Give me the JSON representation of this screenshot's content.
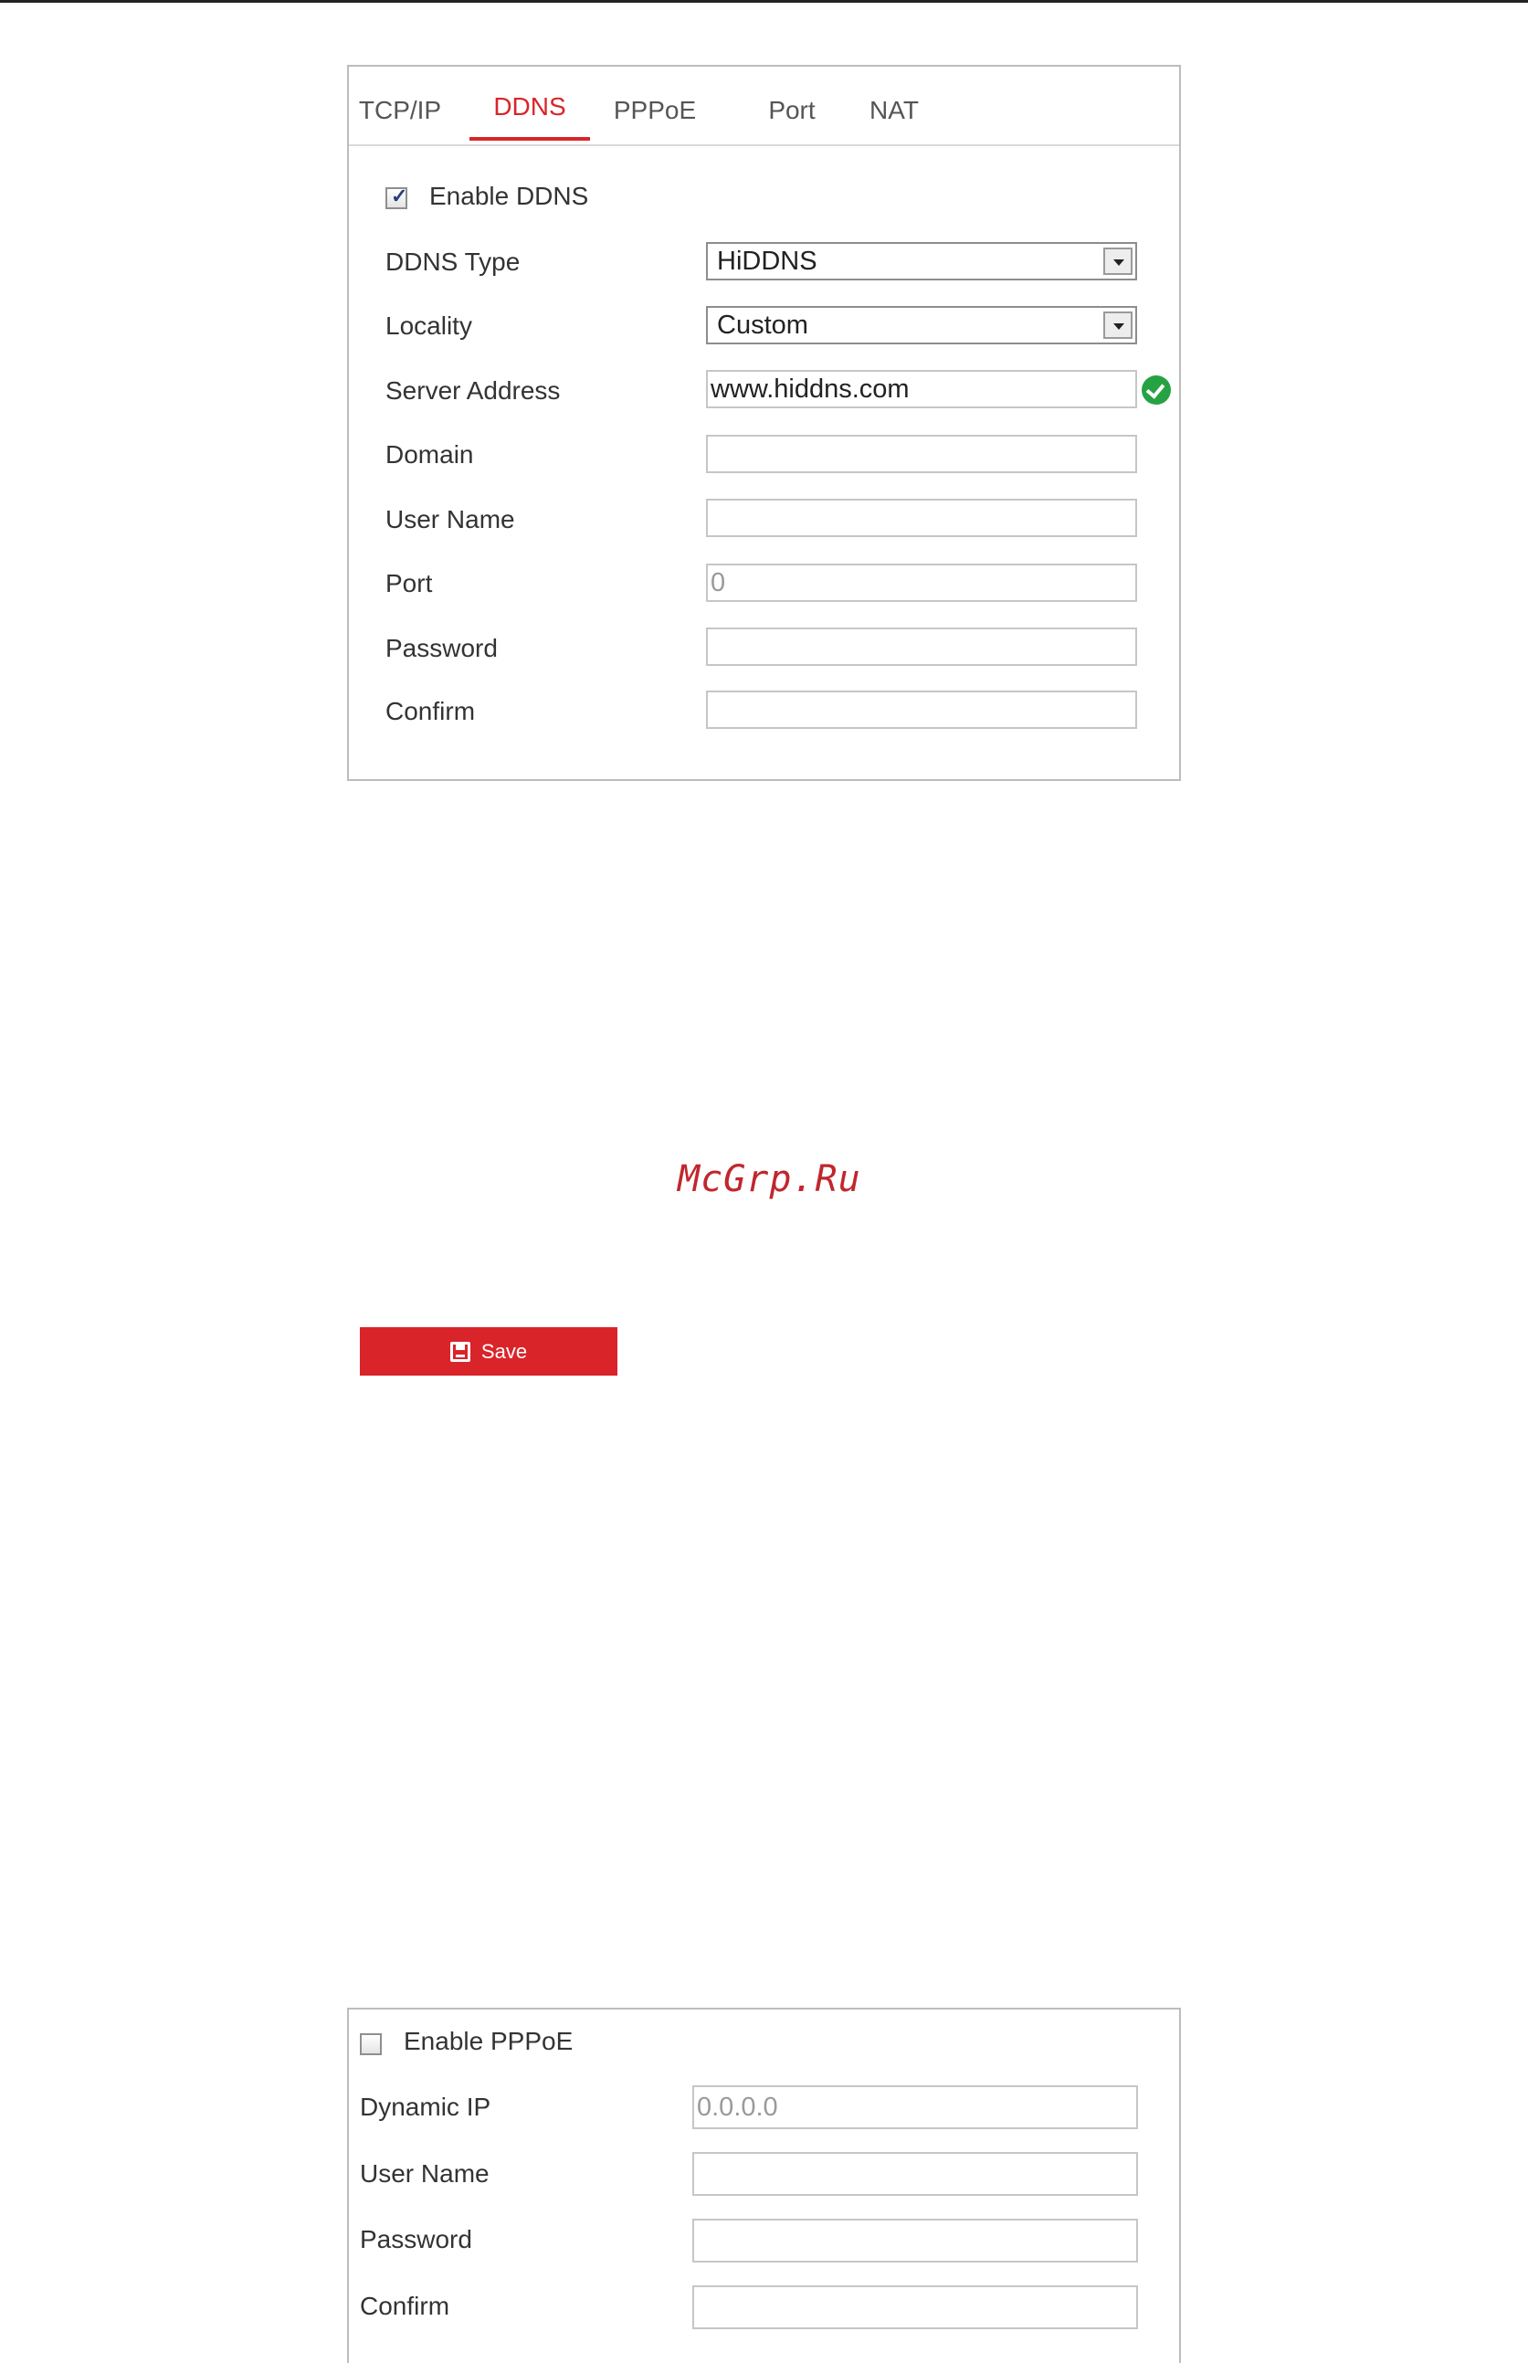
{
  "ddns": {
    "tabs": [
      {
        "label": "TCP/IP",
        "active": false
      },
      {
        "label": "DDNS",
        "active": true
      },
      {
        "label": "PPPoE",
        "active": false
      },
      {
        "label": "Port",
        "active": false
      },
      {
        "label": "NAT",
        "active": false
      }
    ],
    "enable_label": "Enable DDNS",
    "enable_checked": true,
    "type_label": "DDNS Type",
    "type_value": "HiDDNS",
    "locality_label": "Locality",
    "locality_value": "Custom",
    "server_label": "Server Address",
    "server_value": "www.hiddns.com",
    "domain_label": "Domain",
    "domain_value": "",
    "username_label": "User Name",
    "username_value": "",
    "port_label": "Port",
    "port_value": "0",
    "password_label": "Password",
    "password_value": "",
    "confirm_label": "Confirm",
    "confirm_value": ""
  },
  "watermark": "McGrp.Ru",
  "save": {
    "label": "Save"
  },
  "pppoe": {
    "enable_label": "Enable PPPoE",
    "enable_checked": false,
    "dynamic_ip_label": "Dynamic IP",
    "dynamic_ip_value": "0.0.0.0",
    "username_label": "User Name",
    "username_value": "",
    "password_label": "Password",
    "password_value": "",
    "confirm_label": "Confirm",
    "confirm_value": ""
  },
  "colors": {
    "accent": "#d9242a",
    "valid": "#26a243"
  }
}
